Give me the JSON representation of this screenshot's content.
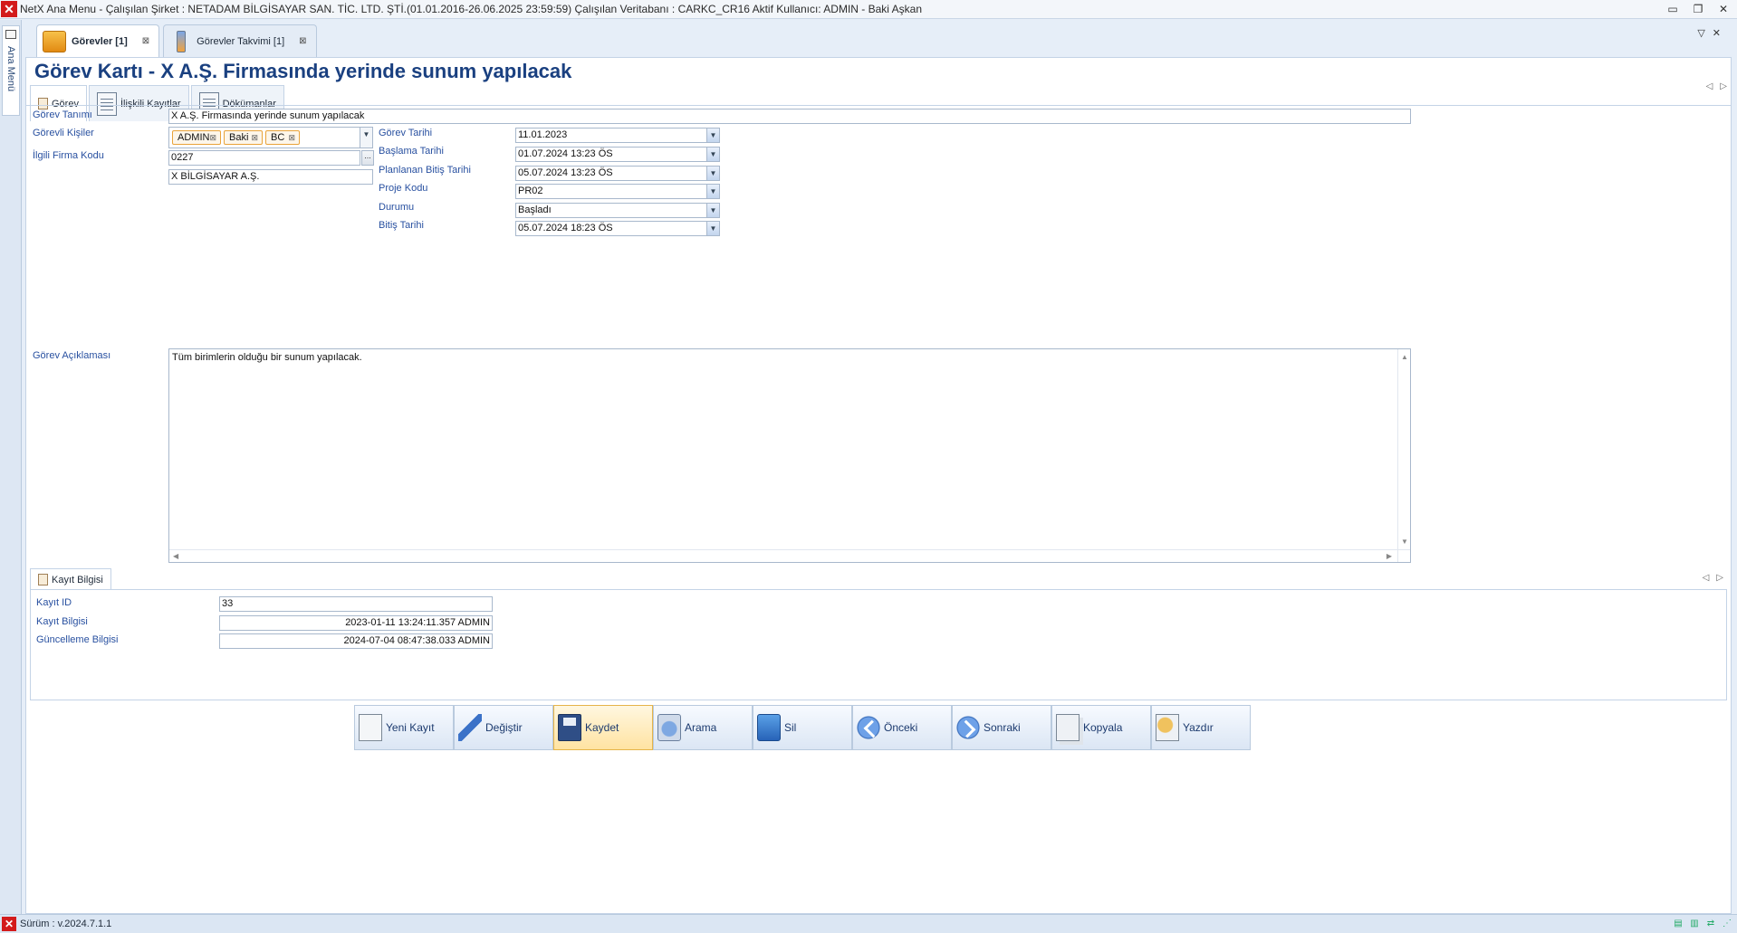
{
  "window": {
    "title": "NetX Ana Menu - Çalışılan Şirket : NETADAM BİLGİSAYAR SAN. TİC. LTD. ŞTİ.(01.01.2016-26.06.2025 23:59:59) Çalışılan Veritabanı : CARKC_CR16  Aktif Kullanıcı: ADMIN - Baki Aşkan"
  },
  "left_rail": {
    "label": "Ana Menü"
  },
  "doc_tabs": [
    {
      "label": "Görevler [1]",
      "icon": "folder-icon",
      "active": true
    },
    {
      "label": "Görevler Takvimi [1]",
      "icon": "calendar-icon",
      "active": false
    }
  ],
  "page_title": "Görev Kartı - X A.Ş. Firmasında yerinde sunum yapılacak",
  "inner_tabs": [
    {
      "label": "Görev",
      "icon": "task-icon"
    },
    {
      "label": "İlişkili Kayıtlar",
      "icon": "related-records-icon"
    },
    {
      "label": "Dökümanlar",
      "icon": "documents-icon"
    }
  ],
  "form": {
    "gorev_tanimi": {
      "label": "Görev Tanımı",
      "value": "X A.Ş. Firmasında yerinde sunum yapılacak"
    },
    "gorevli_kisiler": {
      "label": "Görevli Kişiler",
      "tokens": [
        "ADMIN",
        "Baki",
        "BC"
      ]
    },
    "ilgili_firma_kodu": {
      "label": "İlgili Firma Kodu",
      "value": "0227",
      "firm_name": "X BİLGİSAYAR A.Ş."
    },
    "gorev_tarihi": {
      "label": "Görev Tarihi",
      "value": "11.01.2023"
    },
    "baslama_tarihi": {
      "label": "Başlama Tarihi",
      "value": "01.07.2024 13:23 ÖS"
    },
    "planlanan_bitis": {
      "label": "Planlanan Bitiş Tarihi",
      "value": "05.07.2024 13:23 ÖS"
    },
    "proje_kodu": {
      "label": "Proje Kodu",
      "value": "PR02"
    },
    "durumu": {
      "label": "Durumu",
      "value": "Başladı"
    },
    "bitis_tarihi": {
      "label": "Bitiş Tarihi",
      "value": "05.07.2024 18:23 ÖS"
    },
    "aciklama": {
      "label": "Görev Açıklaması",
      "value": "Tüm birimlerin olduğu bir sunum yapılacak."
    }
  },
  "kayit_bilgisi": {
    "tab_label": "Kayıt Bilgisi",
    "kayit_id": {
      "label": "Kayıt ID",
      "value": "33"
    },
    "kayit": {
      "label": "Kayıt Bilgisi",
      "value": "2023-01-11 13:24:11.357 ADMIN"
    },
    "guncelleme": {
      "label": "Güncelleme Bilgisi",
      "value": "2024-07-04 08:47:38.033 ADMIN"
    }
  },
  "toolbar": {
    "yeni": "Yeni Kayıt",
    "degistir": "Değiştir",
    "kaydet": "Kaydet",
    "arama": "Arama",
    "sil": "Sil",
    "onceki": "Önceki",
    "sonraki": "Sonraki",
    "kopyala": "Kopyala",
    "yazdir": "Yazdır"
  },
  "status": {
    "version": "Sürüm : v.2024.7.1.1"
  },
  "colors": {
    "title_blue": "#1a4080",
    "label_blue": "#2850a0",
    "token_border": "#e9a33a",
    "app_red": "#d31b1b"
  }
}
